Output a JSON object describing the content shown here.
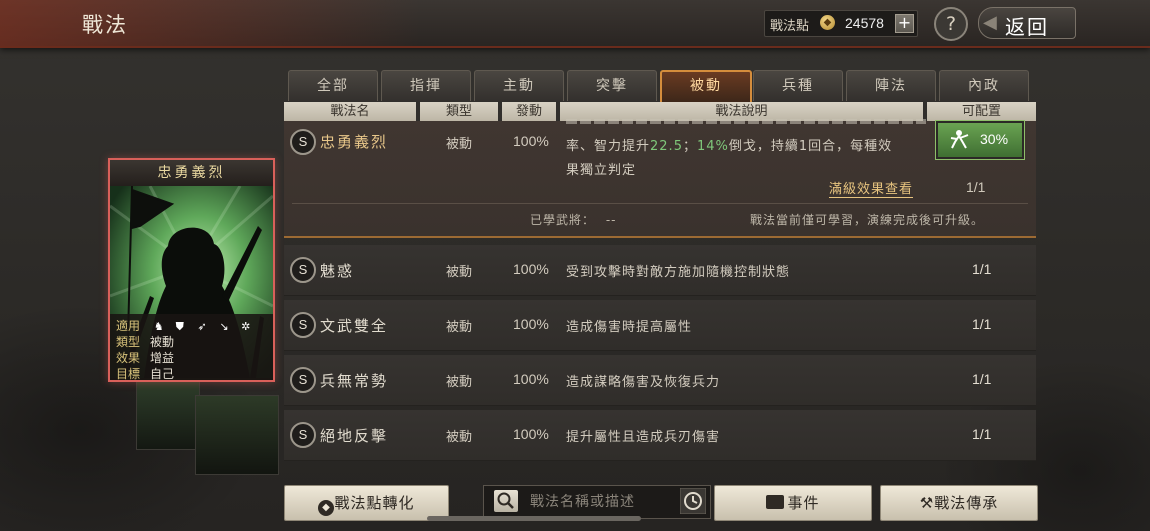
{
  "header": {
    "title": "戰法",
    "points_label": "戰法點",
    "points_value": "24578",
    "add_symbol": "+",
    "help_symbol": "?",
    "back_label": "返回"
  },
  "tabs": [
    {
      "label": "全部",
      "active": false
    },
    {
      "label": "指揮",
      "active": false
    },
    {
      "label": "主動",
      "active": false
    },
    {
      "label": "突擊",
      "active": false
    },
    {
      "label": "被動",
      "active": true
    },
    {
      "label": "兵種",
      "active": false
    },
    {
      "label": "陣法",
      "active": false
    },
    {
      "label": "內政",
      "active": false
    }
  ],
  "columns": {
    "name": "戰法名",
    "type": "類型",
    "rate": "發動",
    "desc": "戰法說明",
    "config": "可配置"
  },
  "expanded": {
    "badge": "S",
    "name": "忠勇義烈",
    "type": "被動",
    "rate": "100%",
    "desc_line1_a": "率、智力提升",
    "desc_line1_b": "22.5",
    "desc_line1_c": "；",
    "desc_line1_d": "14%",
    "desc_line1_e": "倒戈，持續1回合，每種效",
    "desc_line2": "果獨立判定",
    "config_pct": "30%",
    "full_effect_link": "滿級效果查看",
    "count": "1/1",
    "learned_label": "已學武將：",
    "learned_value": "--",
    "note": "戰法當前僅可學習，演練完成後可升級。"
  },
  "rows": [
    {
      "badge": "S",
      "name": "魅惑",
      "type": "被動",
      "rate": "100%",
      "desc": "受到攻擊時對敵方施加隨機控制狀態",
      "count": "1/1"
    },
    {
      "badge": "S",
      "name": "文武雙全",
      "type": "被動",
      "rate": "100%",
      "desc": "造成傷害時提高屬性",
      "count": "1/1"
    },
    {
      "badge": "S",
      "name": "兵無常勢",
      "type": "被動",
      "rate": "100%",
      "desc": "造成謀略傷害及恢復兵力",
      "count": "1/1"
    },
    {
      "badge": "S",
      "name": "絕地反擊",
      "type": "被動",
      "rate": "100%",
      "desc": "提升屬性且造成兵刃傷害",
      "count": "1/1"
    }
  ],
  "card": {
    "title": "忠勇義烈",
    "applicable_label": "適用",
    "type_label": "類型",
    "type_value": "被動",
    "effect_label": "效果",
    "effect_value": "增益",
    "target_label": "目標",
    "target_value": "自己",
    "unit_icons": [
      "cavalry-icon",
      "shield-icon",
      "bow-icon",
      "spear-icon",
      "wheel-icon"
    ]
  },
  "bottom": {
    "convert_label": "戰法點轉化",
    "search_placeholder": "戰法名稱或描述",
    "events_label": "事件",
    "inherit_label": "戰法傳承"
  },
  "colors": {
    "accent_orange": "#d58d3c",
    "config_green": "#4f8a3c",
    "highlight_green": "#6fbf73",
    "card_border": "#d9605a"
  }
}
